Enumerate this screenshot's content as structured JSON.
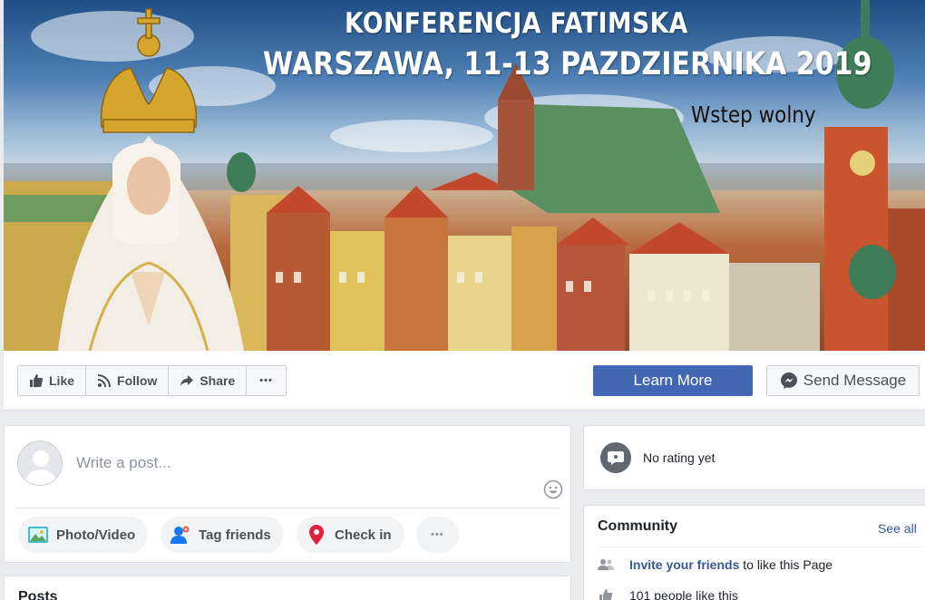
{
  "cover": {
    "line1": "KONFERENCJA FATIMSKA",
    "line2": "WARSZAWA, 11-13 PAZDZIERNIKA 2019",
    "line3": "Wstep wolny"
  },
  "actions": {
    "like": "Like",
    "follow": "Follow",
    "share": "Share",
    "more": "•••",
    "learn_more": "Learn More",
    "send_message": "Send Message"
  },
  "composer": {
    "placeholder": "Write a post...",
    "photo_video": "Photo/Video",
    "tag_friends": "Tag friends",
    "check_in": "Check in",
    "more": "•••"
  },
  "rating": {
    "text": "No rating yet"
  },
  "community": {
    "title": "Community",
    "see_all": "See all",
    "invite_link": "Invite your friends",
    "invite_rest": " to like this Page",
    "likes": "101 people like this"
  },
  "posts": {
    "title": "Posts"
  },
  "colors": {
    "brand": "#4267b2",
    "link": "#365899",
    "checkin_red": "#e41e3f"
  }
}
